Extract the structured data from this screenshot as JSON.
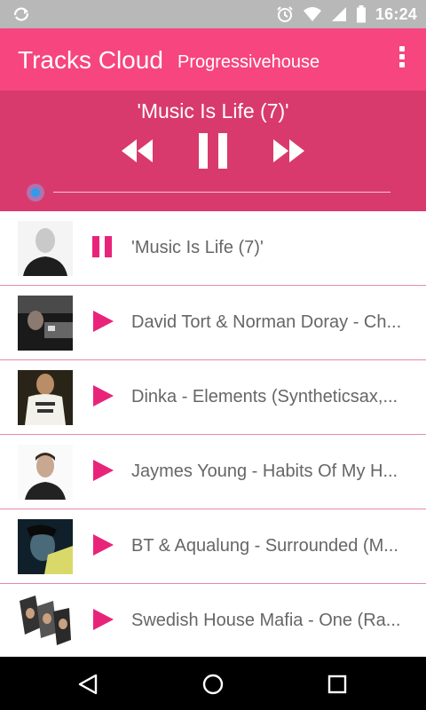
{
  "status_bar": {
    "time": "16:24",
    "icons": [
      "sync-icon",
      "alarm-icon",
      "wifi-icon",
      "signal-icon",
      "battery-icon"
    ]
  },
  "toolbar": {
    "title": "Tracks Cloud",
    "subtitle": "Progressivehouse",
    "menu_icon": "overflow-menu-icon"
  },
  "player": {
    "now_playing": "'Music Is Life (7)'",
    "controls": [
      "rewind-icon",
      "pause-icon",
      "fast-forward-icon"
    ],
    "progress": 0
  },
  "tracks": [
    {
      "title": "'Music Is Life (7)'",
      "state": "paused-playing"
    },
    {
      "title": "David Tort & Norman Doray - Ch...",
      "state": "idle"
    },
    {
      "title": "Dinka - Elements (Syntheticsax,...",
      "state": "idle"
    },
    {
      "title": "Jaymes Young - Habits Of My H...",
      "state": "idle"
    },
    {
      "title": "BT & Aqualung - Surrounded (M...",
      "state": "idle"
    },
    {
      "title": "Swedish House Mafia - One (Ra...",
      "state": "idle"
    }
  ],
  "colors": {
    "toolbar": "#f6457f",
    "player": "#d93a6e",
    "accent": "#e8247a",
    "divider": "#e68aa8"
  },
  "navigation": [
    "back-icon",
    "home-icon",
    "recents-icon"
  ]
}
